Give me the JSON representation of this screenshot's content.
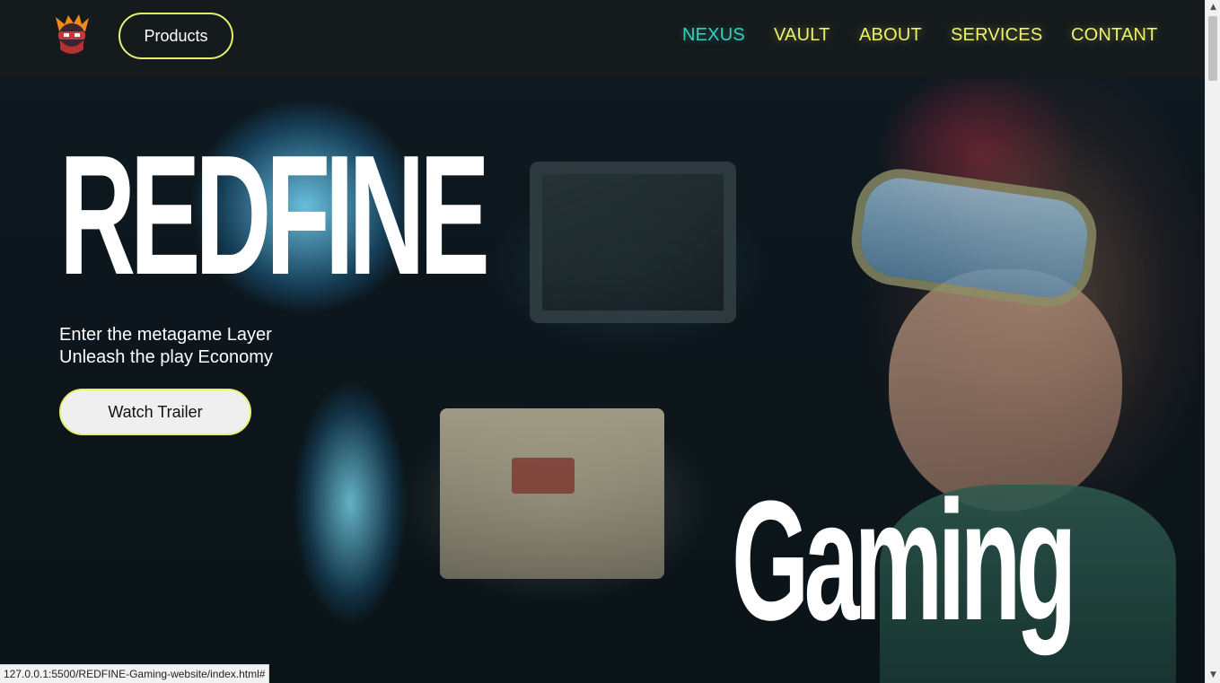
{
  "header": {
    "logo_icon": "ninja-avatar-logo-icon",
    "products_label": "Products",
    "nav": {
      "nexus": "NEXUS",
      "vault": "VAULT",
      "about": "ABOUT",
      "services": "SERVICES",
      "contant": "CONTANT"
    },
    "colors": {
      "accent": "#e9f06d",
      "active_nav": "#33d1c0"
    }
  },
  "hero": {
    "title": "REDFINE",
    "tagline_line1": "Enter the metagame Layer",
    "tagline_line2": "Unleash the play Economy",
    "cta_label": "Watch Trailer",
    "bottom_word": "Gaming"
  },
  "status_bar": {
    "url": "127.0.0.1:5500/REDFINE-Gaming-website/index.html#"
  },
  "scrollbar": {
    "up_icon": "scroll-up-arrow-icon",
    "down_icon": "scroll-down-arrow-icon"
  }
}
